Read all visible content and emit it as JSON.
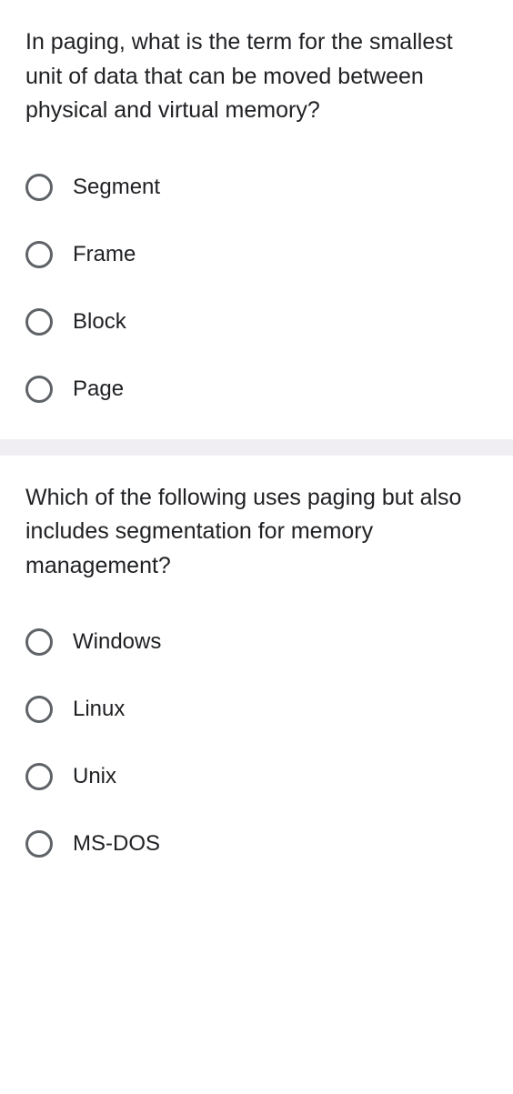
{
  "questions": [
    {
      "text": "In paging, what is the term for the smallest unit of data that can be moved between physical and virtual memory?",
      "options": [
        "Segment",
        "Frame",
        "Block",
        "Page"
      ]
    },
    {
      "text": "Which of the following uses paging but also includes segmentation for memory management?",
      "options": [
        "Windows",
        "Linux",
        "Unix",
        "MS-DOS"
      ]
    }
  ]
}
